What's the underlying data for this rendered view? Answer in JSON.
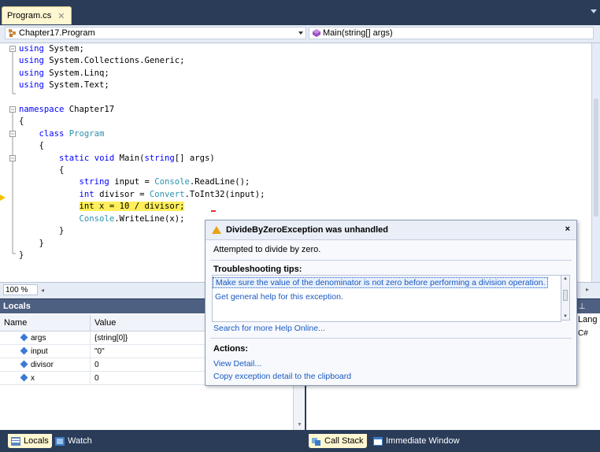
{
  "tab": {
    "label": "Program.cs",
    "close": "✕"
  },
  "nav": {
    "type_combo": "Chapter17.Program",
    "member_combo": "Main(string[] args)"
  },
  "code": {
    "lines": [
      [
        {
          "t": "using",
          "c": "kw"
        },
        {
          "t": " System;"
        }
      ],
      [
        {
          "t": "using",
          "c": "kw"
        },
        {
          "t": " System.Collections.Generic;"
        }
      ],
      [
        {
          "t": "using",
          "c": "kw"
        },
        {
          "t": " System.Linq;"
        }
      ],
      [
        {
          "t": "using",
          "c": "kw"
        },
        {
          "t": " System.Text;"
        }
      ],
      [],
      [
        {
          "t": "namespace",
          "c": "kw"
        },
        {
          "t": " Chapter17"
        }
      ],
      [
        {
          "t": "{"
        }
      ],
      [
        {
          "t": "    "
        },
        {
          "t": "class",
          "c": "kw"
        },
        {
          "t": " "
        },
        {
          "t": "Program",
          "c": "ty"
        }
      ],
      [
        {
          "t": "    {"
        }
      ],
      [
        {
          "t": "        "
        },
        {
          "t": "static",
          "c": "kw"
        },
        {
          "t": " "
        },
        {
          "t": "void",
          "c": "kw"
        },
        {
          "t": " Main("
        },
        {
          "t": "string",
          "c": "kw"
        },
        {
          "t": "[] args)"
        }
      ],
      [
        {
          "t": "        {"
        }
      ],
      [
        {
          "t": "            "
        },
        {
          "t": "string",
          "c": "kw"
        },
        {
          "t": " input = "
        },
        {
          "t": "Console",
          "c": "ty"
        },
        {
          "t": ".ReadLine();"
        }
      ],
      [
        {
          "t": "            "
        },
        {
          "t": "int",
          "c": "kw"
        },
        {
          "t": " divisor = "
        },
        {
          "t": "Convert",
          "c": "ty"
        },
        {
          "t": ".ToInt32(input);"
        }
      ],
      [
        {
          "t": "            "
        },
        {
          "t": "int x = 10 / divisor;",
          "c": "hl"
        }
      ],
      [
        {
          "t": "            "
        },
        {
          "t": "Console",
          "c": "ty"
        },
        {
          "t": ".WriteLine(x);"
        }
      ],
      [
        {
          "t": "        }"
        }
      ],
      [
        {
          "t": "    }"
        }
      ],
      [
        {
          "t": "}"
        }
      ]
    ]
  },
  "zoom": {
    "value": "100 %"
  },
  "locals": {
    "title": "Locals",
    "columns": [
      "Name",
      "Value"
    ],
    "rows": [
      {
        "name": "args",
        "value": "{string[0]}"
      },
      {
        "name": "input",
        "value": "\"0\""
      },
      {
        "name": "divisor",
        "value": "0"
      },
      {
        "name": "x",
        "value": "0"
      }
    ]
  },
  "callstack": {
    "lang_header": "Lang",
    "lang_value": "C#"
  },
  "bottom_tabs": {
    "left": [
      "Locals",
      "Watch"
    ],
    "right": [
      "Call Stack",
      "Immediate Window"
    ]
  },
  "exception": {
    "title": "DivideByZeroException was unhandled",
    "close": "×",
    "message": "Attempted to divide by zero.",
    "tips_heading": "Troubleshooting tips:",
    "tips": [
      "Make sure the value of the denominator is not zero before performing a division operation.",
      "Get general help for this exception."
    ],
    "search_link": "Search for more Help Online...",
    "actions_heading": "Actions:",
    "actions": [
      "View Detail...",
      "Copy exception detail to the clipboard"
    ]
  }
}
